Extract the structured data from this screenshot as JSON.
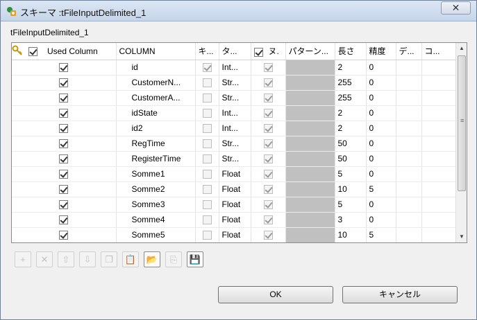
{
  "window": {
    "title": "スキーマ :tFileInputDelimited_1",
    "close_glyph": "✕"
  },
  "panel": {
    "title": "tFileInputDelimited_1"
  },
  "table": {
    "headers": {
      "used_column": "Used Column",
      "column": "COLUMN",
      "key": "キ...",
      "type": "タ...",
      "nullable": "ヌ.",
      "pattern": "パターン...",
      "length": "長さ",
      "precision": "精度",
      "default": "デ...",
      "comment": "コ..."
    },
    "rows": [
      {
        "used": true,
        "column": "id",
        "key": true,
        "type": "Int...",
        "nullable": true,
        "length": "2",
        "precision": "0",
        "is_key": true
      },
      {
        "used": true,
        "column": "CustomerN...",
        "key": false,
        "type": "Str...",
        "nullable": true,
        "length": "255",
        "precision": "0"
      },
      {
        "used": true,
        "column": "CustomerA...",
        "key": false,
        "type": "Str...",
        "nullable": true,
        "length": "255",
        "precision": "0"
      },
      {
        "used": true,
        "column": "idState",
        "key": false,
        "type": "Int...",
        "nullable": true,
        "length": "2",
        "precision": "0"
      },
      {
        "used": true,
        "column": "id2",
        "key": false,
        "type": "Int...",
        "nullable": true,
        "length": "2",
        "precision": "0"
      },
      {
        "used": true,
        "column": "RegTime",
        "key": false,
        "type": "Str...",
        "nullable": true,
        "length": "50",
        "precision": "0"
      },
      {
        "used": true,
        "column": "RegisterTime",
        "key": false,
        "type": "Str...",
        "nullable": true,
        "length": "50",
        "precision": "0"
      },
      {
        "used": true,
        "column": "Somme1",
        "key": false,
        "type": "Float",
        "nullable": true,
        "length": "5",
        "precision": "0"
      },
      {
        "used": true,
        "column": "Somme2",
        "key": false,
        "type": "Float",
        "nullable": true,
        "length": "10",
        "precision": "5"
      },
      {
        "used": true,
        "column": "Somme3",
        "key": false,
        "type": "Float",
        "nullable": true,
        "length": "5",
        "precision": "0"
      },
      {
        "used": true,
        "column": "Somme4",
        "key": false,
        "type": "Float",
        "nullable": true,
        "length": "3",
        "precision": "0"
      },
      {
        "used": true,
        "column": "Somme5",
        "key": false,
        "type": "Float",
        "nullable": true,
        "length": "10",
        "precision": "5"
      }
    ]
  },
  "toolbar": {
    "buttons": [
      {
        "name": "add-row-button",
        "glyph": "+",
        "enabled": false
      },
      {
        "name": "remove-row-button",
        "glyph": "✕",
        "enabled": false
      },
      {
        "name": "move-up-button",
        "glyph": "⇧",
        "enabled": false
      },
      {
        "name": "move-down-button",
        "glyph": "⇩",
        "enabled": false
      },
      {
        "name": "copy-button",
        "glyph": "❐",
        "enabled": false
      },
      {
        "name": "paste-button",
        "glyph": "📋",
        "enabled": false
      },
      {
        "name": "import-button",
        "glyph": "📂",
        "enabled": true
      },
      {
        "name": "export-button",
        "glyph": "⎘",
        "enabled": false
      },
      {
        "name": "save-button",
        "glyph": "💾",
        "enabled": true
      }
    ]
  },
  "buttons": {
    "ok": "OK",
    "cancel": "キャンセル"
  },
  "colors": {
    "title_bg": "#c6d5e9",
    "gray_cell": "#c0c0c0"
  }
}
